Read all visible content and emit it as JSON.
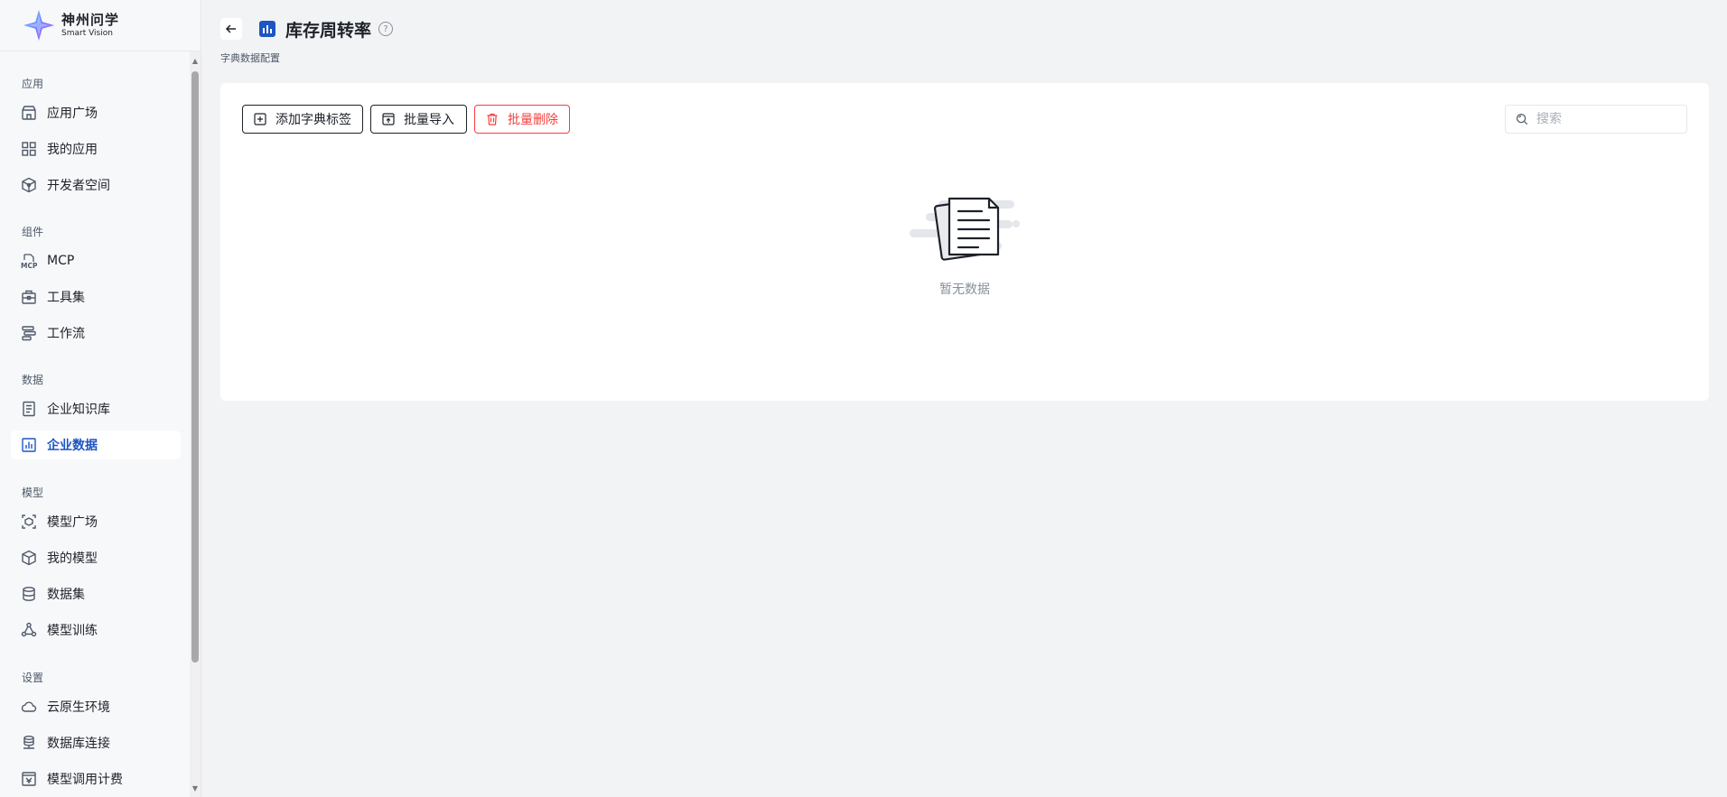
{
  "brand": {
    "name_cn": "神州问学",
    "name_en": "Smart Vision"
  },
  "sidebar": {
    "sections": [
      {
        "label": "应用",
        "items": [
          {
            "label": "应用广场",
            "icon": "store-icon"
          },
          {
            "label": "我的应用",
            "icon": "grid-icon"
          },
          {
            "label": "开发者空间",
            "icon": "cube-network-icon"
          }
        ]
      },
      {
        "label": "组件",
        "items": [
          {
            "label": "MCP",
            "icon": "mcp-icon"
          },
          {
            "label": "工具集",
            "icon": "toolbox-icon"
          },
          {
            "label": "工作流",
            "icon": "workflow-icon"
          }
        ]
      },
      {
        "label": "数据",
        "items": [
          {
            "label": "企业知识库",
            "icon": "knowledge-base-icon"
          },
          {
            "label": "企业数据",
            "icon": "bar-chart-icon",
            "active": true
          }
        ]
      },
      {
        "label": "模型",
        "items": [
          {
            "label": "模型广场",
            "icon": "model-scan-icon"
          },
          {
            "label": "我的模型",
            "icon": "box-icon"
          },
          {
            "label": "数据集",
            "icon": "database-icon"
          },
          {
            "label": "模型训练",
            "icon": "training-icon"
          }
        ]
      },
      {
        "label": "设置",
        "items": [
          {
            "label": "云原生环境",
            "icon": "cloud-icon"
          },
          {
            "label": "数据库连接",
            "icon": "database-connect-icon"
          },
          {
            "label": "模型调用计费",
            "icon": "billing-icon"
          }
        ]
      }
    ]
  },
  "header": {
    "title": "库存周转率",
    "help": "?",
    "subtitle": "字典数据配置"
  },
  "toolbar": {
    "add_label": "添加字典标签",
    "import_label": "批量导入",
    "delete_label": "批量删除",
    "search_placeholder": "搜索"
  },
  "empty": {
    "text": "暂无数据"
  },
  "colors": {
    "accent": "#1d55c4",
    "danger": "#f53f3f",
    "background": "#f2f3f5"
  }
}
